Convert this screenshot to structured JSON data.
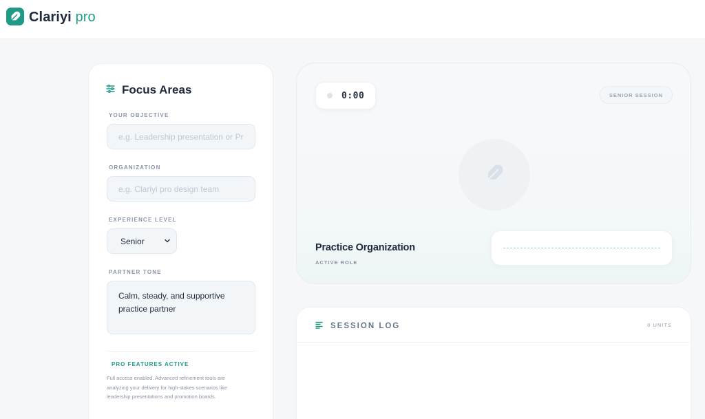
{
  "app": {
    "brand_main": "Clariyi",
    "brand_accent": "pro",
    "accent_color": "#1f9a86"
  },
  "sidebar": {
    "title": "Focus Areas",
    "objective": {
      "label": "YOUR OBJECTIVE",
      "placeholder": "e.g. Leadership presentation or Promotion board"
    },
    "organization": {
      "label": "ORGANIZATION",
      "placeholder": "e.g. Clariyi pro design team"
    },
    "experience": {
      "label": "EXPERIENCE LEVEL",
      "value": "Senior"
    },
    "tone": {
      "label": "PARTNER TONE",
      "value": "Calm, steady, and supportive practice partner"
    },
    "pro": {
      "title": "PRO FEATURES ACTIVE",
      "description": "Full access enabled. Advanced refinement tools are analyzing your delivery for high-stakes scenarios like leadership presentations and promotion boards."
    }
  },
  "stage": {
    "timer": "0:00",
    "session_badge": "SENIOR SESSION",
    "role_name": "Practice Organization",
    "role_label": "ACTIVE ROLE"
  },
  "log": {
    "title": "SESSION LOG",
    "units": "0 UNITS"
  },
  "icons": {
    "logo": "feather-icon",
    "focus": "sliders-icon",
    "avatar": "feather-icon",
    "log": "list-icon",
    "select": "chevron-down-icon"
  }
}
